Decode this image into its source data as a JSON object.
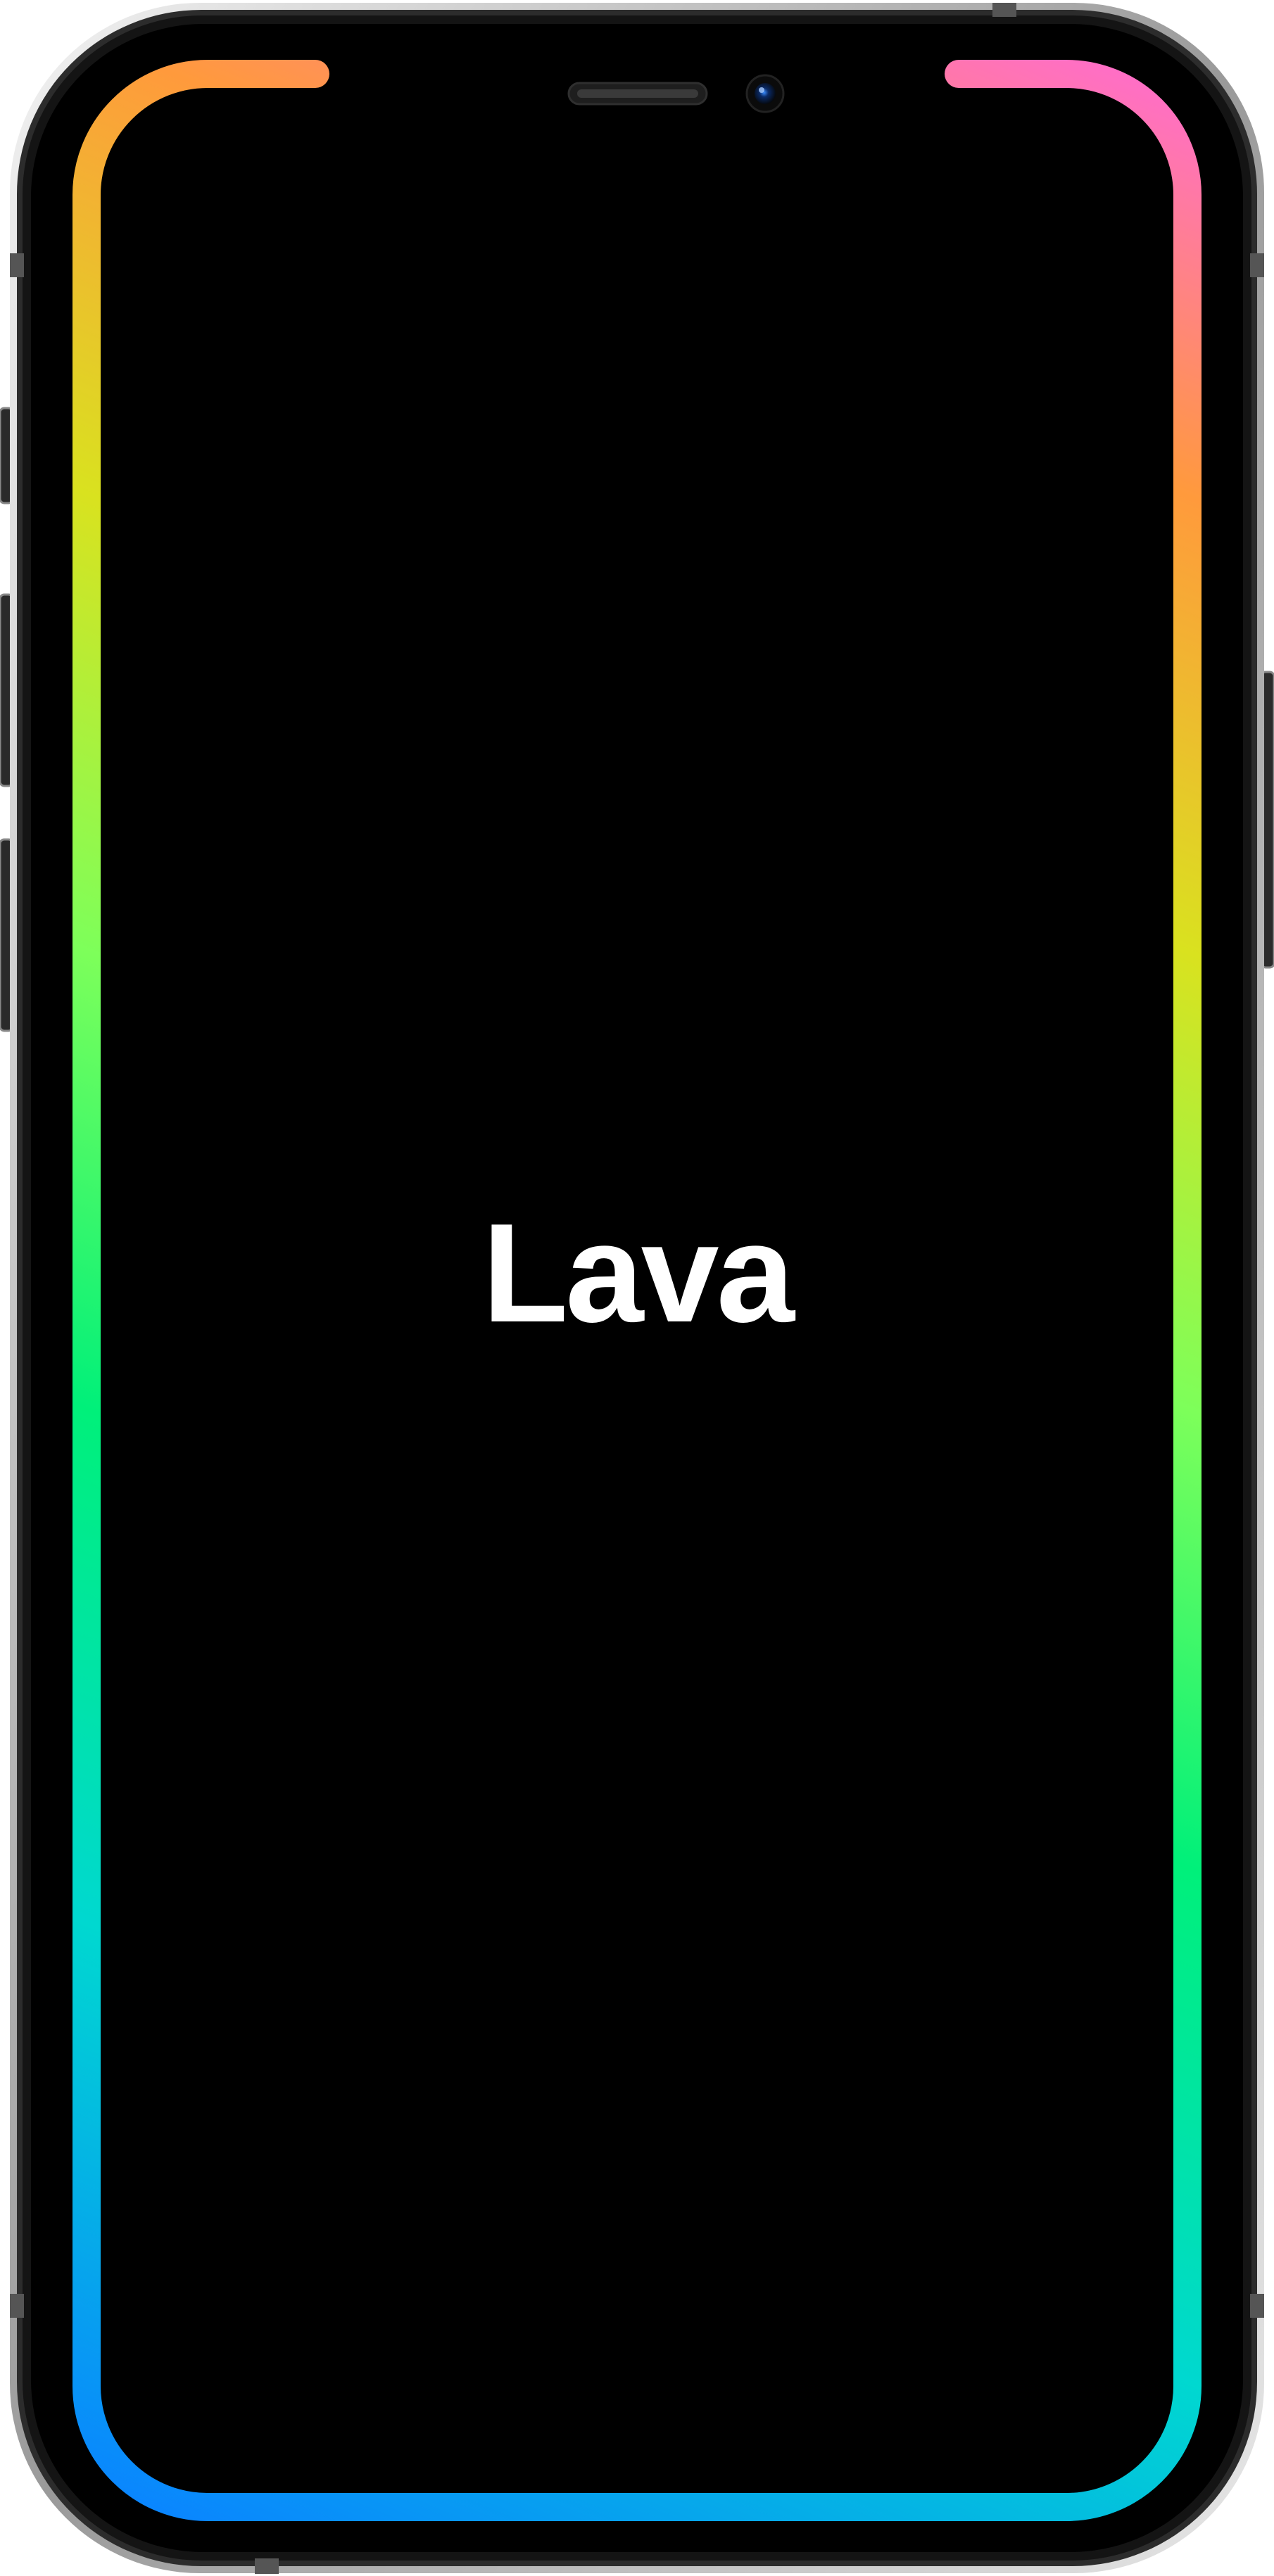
{
  "splash": {
    "app_name": "Lava"
  },
  "device": {
    "model_style": "iphone-notch",
    "frame_color": "#1a1a1a",
    "screen_color": "#000000",
    "rim_color": "#cfcfcf"
  },
  "border_glow": {
    "gradient_colors": [
      "#ff6ec7",
      "#ff9a3c",
      "#d9e21f",
      "#7dff5a",
      "#00f07a",
      "#00d8d0",
      "#0a84ff"
    ]
  },
  "icons": {
    "earpiece": "speaker-grille-icon",
    "front_camera": "front-camera-icon"
  }
}
